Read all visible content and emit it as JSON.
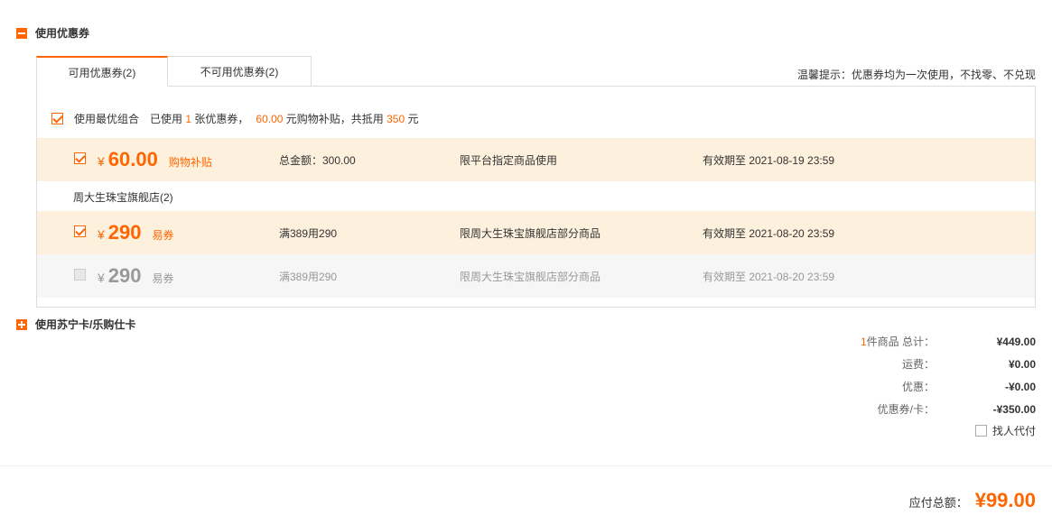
{
  "coupon_section": {
    "title": "使用优惠券"
  },
  "tabs": [
    {
      "label": "可用优惠券(2)"
    },
    {
      "label": "不可用优惠券(2)"
    }
  ],
  "tip": "温馨提示：优惠券均为一次使用，不找零、不兑现",
  "best_combo": {
    "label": "使用最优组合",
    "used_prefix": "已使用 ",
    "used_count": "1",
    "used_mid": " 张优惠券，",
    "subsidy_amount": "60.00",
    "subsidy_mid": " 元购物补贴，共抵用 ",
    "total_discount": "350",
    "unit": " 元"
  },
  "platform_coupon": {
    "yen": "¥",
    "amount": "60.00",
    "kind": "购物补贴",
    "condition": "总金额：300.00",
    "scope": "限平台指定商品使用",
    "validity": "有效期至 2021-08-19 23:59"
  },
  "store": {
    "label": "周大生珠宝旗舰店(2)"
  },
  "store_coupons": [
    {
      "yen": "¥",
      "amount": "290",
      "kind": "易券",
      "condition": "满389用290",
      "scope": "限周大生珠宝旗舰店部分商品",
      "validity": "有效期至 2021-08-20 23:59"
    },
    {
      "yen": "¥",
      "amount": "290",
      "kind": "易券",
      "condition": "满389用290",
      "scope": "限周大生珠宝旗舰店部分商品",
      "validity": "有效期至 2021-08-20 23:59"
    }
  ],
  "card_section": {
    "title": "使用苏宁卡/乐购仕卡"
  },
  "summary": {
    "item_count": "1",
    "item_label": "件商品 总计：",
    "total": "¥449.00",
    "shipping_label": "运费：",
    "shipping": "¥0.00",
    "discount_label": "优惠：",
    "discount": "-¥0.00",
    "coupon_label": "优惠券/卡：",
    "coupon": "-¥350.00"
  },
  "proxy_pay": {
    "label": "找人代付"
  },
  "payable": {
    "label": "应付总额：",
    "value": "¥99.00"
  },
  "colors": {
    "accent": "#ff6600",
    "highlight_row": "#fdf0dc",
    "disabled_row": "#f6f6f6"
  }
}
